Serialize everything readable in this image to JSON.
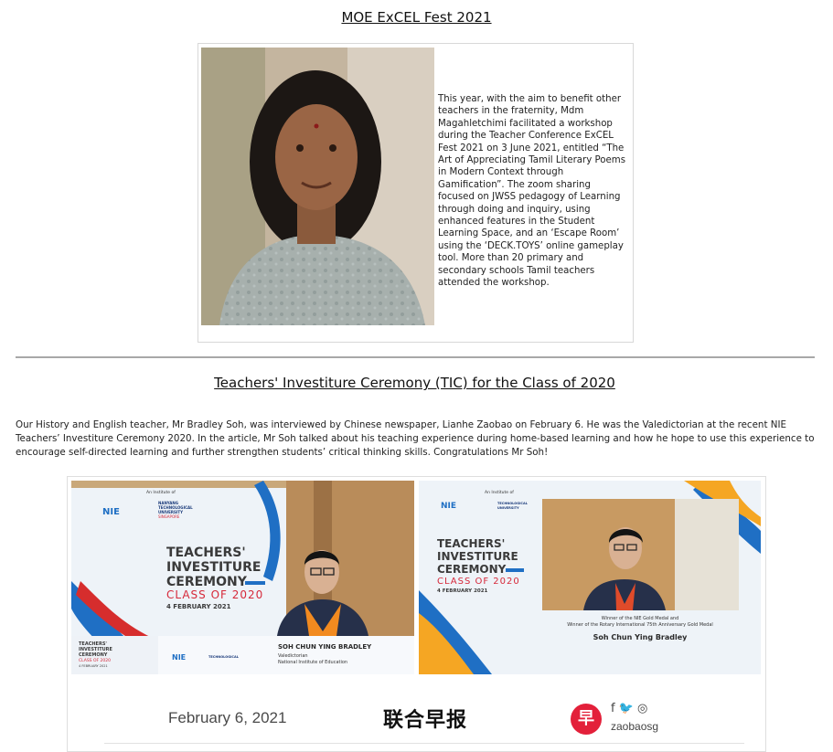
{
  "section1": {
    "title": "MOE ExCEL Fest 2021",
    "body": "This year, with the aim to benefit other teachers in the fraternity, Mdm Magahletchimi facilitated a workshop during the Teacher Conference ExCEL Fest 2021 on 3 June 2021, entitled “The Art of Appreciating Tamil Literary Poems in Modern Context through Gamification”. The zoom sharing focused on JWSS pedagogy of Learning through doing and inquiry, using enhanced features in the Student Learning Space, and an ‘Escape Room’ using the ‘DECK.TOYS’ online gameplay tool. More than 20 primary and secondary schools Tamil teachers attended the workshop."
  },
  "section2": {
    "title": "Teachers' Investiture Ceremony (TIC) for the Class of 2020",
    "body": "Our History and English teacher, Mr Bradley Soh, was interviewed by Chinese newspaper, Lianhe Zaobao on February 6. He was the Valedictorian at the recent NIE Teachers’ Investiture Ceremony 2020. In the article, Mr Soh talked about his teaching experience during home-based learning and how he hope to use this experience to encourage self-directed learning and further strengthen students’ critical thinking skills. Congratulations Mr Soh!"
  },
  "graphic": {
    "institute_note": "An Institute of",
    "nie": "NIE",
    "ntu_line1": "NANYANG",
    "ntu_line2": "TECHNOLOGICAL",
    "ntu_line3": "UNIVERSITY",
    "ntu_line4": "SINGAPORE",
    "ceremony_line1": "TEACHERS'",
    "ceremony_line2": "INVESTITURE",
    "ceremony_line3": "CEREMONY",
    "class_of": "CLASS OF 2020",
    "event_date": "4 FEBRUARY 2021",
    "left_name": "SOH CHUN YING BRADLEY",
    "left_role": "Valedictorian",
    "left_org": "National Institute of Education",
    "right_award1": "Winner of the NIE Gold Medal and",
    "right_award2": "Winner of the Rotary International 75th Anniversary Gold Medal",
    "right_name": "Soh Chun Ying Bradley"
  },
  "footer": {
    "date": "February 6, 2021",
    "paper_logo": "联合早报",
    "badge": "早",
    "social_icons": "f  🐦  ◎",
    "handle": "zaobaosg"
  },
  "colors": {
    "ribbon_blue": "#1f6fc4",
    "ribbon_red": "#d62d2d",
    "ribbon_orange": "#f5a623",
    "class_red": "#d6293a",
    "zaobao_red": "#e3203a"
  }
}
